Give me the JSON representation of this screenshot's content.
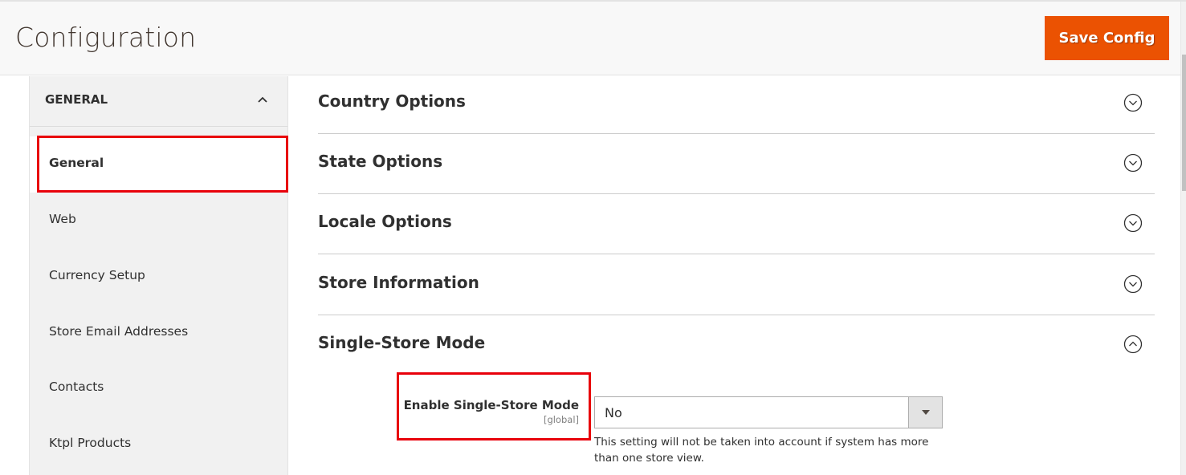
{
  "header": {
    "title": "Configuration",
    "save_button": "Save Config"
  },
  "sidebar": {
    "group_label": "GENERAL",
    "group_expanded": true,
    "items": [
      {
        "label": "General",
        "active": true,
        "highlighted": true
      },
      {
        "label": "Web"
      },
      {
        "label": "Currency Setup"
      },
      {
        "label": "Store Email Addresses"
      },
      {
        "label": "Contacts"
      },
      {
        "label": "Ktpl Products"
      }
    ]
  },
  "sections": [
    {
      "title": "Country Options",
      "icon": "chevron-down-circle-icon",
      "expanded": false
    },
    {
      "title": "State Options",
      "icon": "chevron-down-circle-icon",
      "expanded": false
    },
    {
      "title": "Locale Options",
      "icon": "chevron-down-circle-icon",
      "expanded": false
    },
    {
      "title": "Store Information",
      "icon": "chevron-down-circle-icon",
      "expanded": false
    },
    {
      "title": "Single-Store Mode",
      "icon": "chevron-up-circle-icon",
      "expanded": true
    }
  ],
  "single_store_field": {
    "label": "Enable Single-Store Mode",
    "scope": "[global]",
    "value": "No",
    "note": "This setting will not be taken into account if system has more than one store view.",
    "highlighted": true
  },
  "colors": {
    "accent": "#eb5202",
    "highlight": "#e8000b"
  }
}
